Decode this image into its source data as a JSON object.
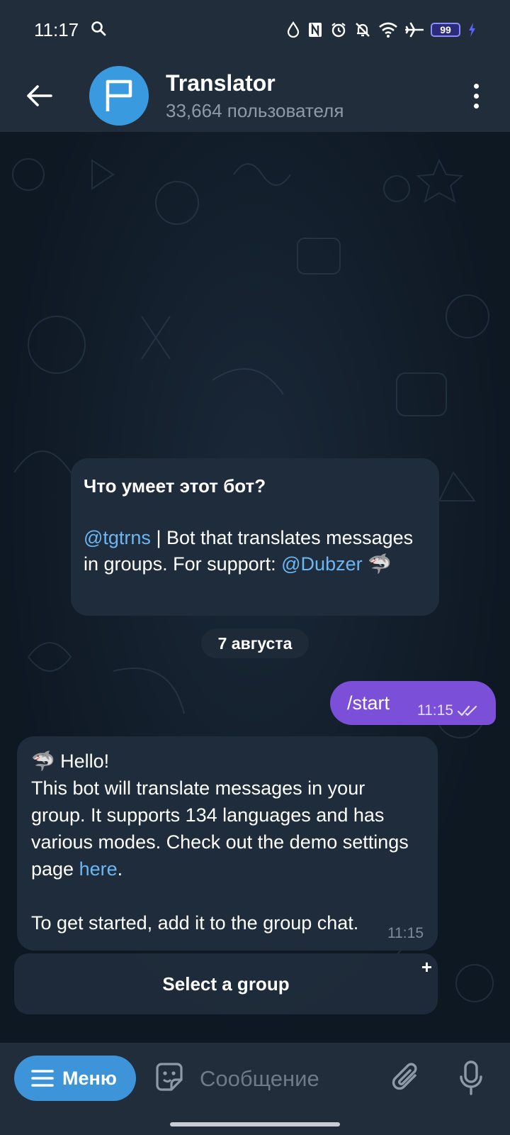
{
  "status_bar": {
    "time": "11:17",
    "battery": "99"
  },
  "header": {
    "title": "Translator",
    "subtitle": "33,664 пользователя"
  },
  "bot_info": {
    "title": "Что умеет этот бот?",
    "handle": "@tgtrns",
    "description": " | Bot that translates messages in groups. For support: ",
    "support_handle": "@Dubzer",
    "emoji": "🦈"
  },
  "date_separator": "7 августа",
  "outgoing_message": {
    "text": "/start",
    "time": "11:15"
  },
  "incoming_message": {
    "emoji": "🦈",
    "text_before_link": " Hello!\nThis bot will translate messages in your group. It supports 134 languages and has various modes. Check out the demo settings page ",
    "link": "here",
    "text_after_link": ".\n\nTo get started, add it to the group chat.",
    "time": "11:15"
  },
  "inline_button": {
    "label": "Select a group",
    "plus": "+"
  },
  "input_bar": {
    "menu_label": "Меню",
    "placeholder": "Сообщение"
  },
  "colors": {
    "header_bg": "#212d3b",
    "accent_blue": "#3d94d8",
    "outgoing_bubble": "#7b4fd8",
    "link": "#6cb7f3"
  }
}
